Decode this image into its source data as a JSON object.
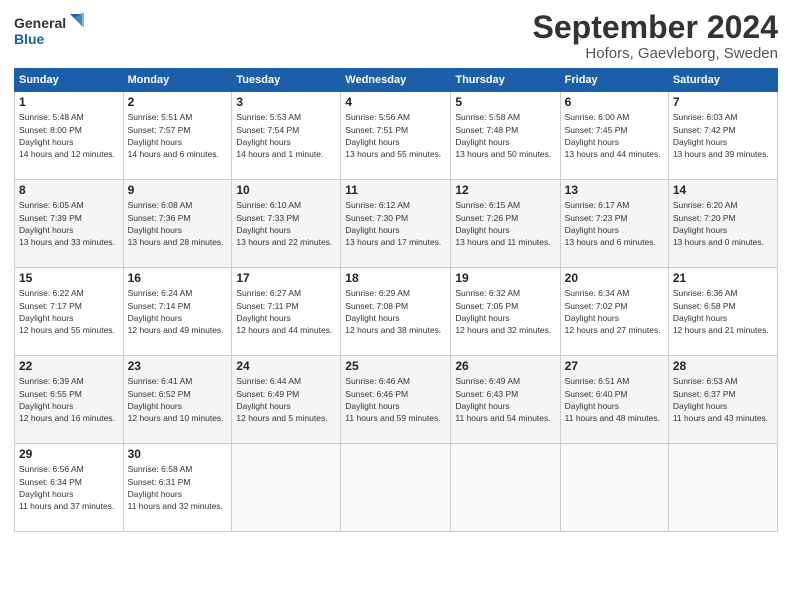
{
  "header": {
    "logo_line1": "General",
    "logo_line2": "Blue",
    "month": "September 2024",
    "location": "Hofors, Gaevleborg, Sweden"
  },
  "weekdays": [
    "Sunday",
    "Monday",
    "Tuesday",
    "Wednesday",
    "Thursday",
    "Friday",
    "Saturday"
  ],
  "weeks": [
    [
      {
        "day": "1",
        "sunrise": "Sunrise: 5:48 AM",
        "sunset": "Sunset: 8:00 PM",
        "daylight": "Daylight: 14 hours and 12 minutes."
      },
      {
        "day": "2",
        "sunrise": "Sunrise: 5:51 AM",
        "sunset": "Sunset: 7:57 PM",
        "daylight": "Daylight: 14 hours and 6 minutes."
      },
      {
        "day": "3",
        "sunrise": "Sunrise: 5:53 AM",
        "sunset": "Sunset: 7:54 PM",
        "daylight": "Daylight: 14 hours and 1 minute."
      },
      {
        "day": "4",
        "sunrise": "Sunrise: 5:56 AM",
        "sunset": "Sunset: 7:51 PM",
        "daylight": "Daylight: 13 hours and 55 minutes."
      },
      {
        "day": "5",
        "sunrise": "Sunrise: 5:58 AM",
        "sunset": "Sunset: 7:48 PM",
        "daylight": "Daylight: 13 hours and 50 minutes."
      },
      {
        "day": "6",
        "sunrise": "Sunrise: 6:00 AM",
        "sunset": "Sunset: 7:45 PM",
        "daylight": "Daylight: 13 hours and 44 minutes."
      },
      {
        "day": "7",
        "sunrise": "Sunrise: 6:03 AM",
        "sunset": "Sunset: 7:42 PM",
        "daylight": "Daylight: 13 hours and 39 minutes."
      }
    ],
    [
      {
        "day": "8",
        "sunrise": "Sunrise: 6:05 AM",
        "sunset": "Sunset: 7:39 PM",
        "daylight": "Daylight: 13 hours and 33 minutes."
      },
      {
        "day": "9",
        "sunrise": "Sunrise: 6:08 AM",
        "sunset": "Sunset: 7:36 PM",
        "daylight": "Daylight: 13 hours and 28 minutes."
      },
      {
        "day": "10",
        "sunrise": "Sunrise: 6:10 AM",
        "sunset": "Sunset: 7:33 PM",
        "daylight": "Daylight: 13 hours and 22 minutes."
      },
      {
        "day": "11",
        "sunrise": "Sunrise: 6:12 AM",
        "sunset": "Sunset: 7:30 PM",
        "daylight": "Daylight: 13 hours and 17 minutes."
      },
      {
        "day": "12",
        "sunrise": "Sunrise: 6:15 AM",
        "sunset": "Sunset: 7:26 PM",
        "daylight": "Daylight: 13 hours and 11 minutes."
      },
      {
        "day": "13",
        "sunrise": "Sunrise: 6:17 AM",
        "sunset": "Sunset: 7:23 PM",
        "daylight": "Daylight: 13 hours and 6 minutes."
      },
      {
        "day": "14",
        "sunrise": "Sunrise: 6:20 AM",
        "sunset": "Sunset: 7:20 PM",
        "daylight": "Daylight: 13 hours and 0 minutes."
      }
    ],
    [
      {
        "day": "15",
        "sunrise": "Sunrise: 6:22 AM",
        "sunset": "Sunset: 7:17 PM",
        "daylight": "Daylight: 12 hours and 55 minutes."
      },
      {
        "day": "16",
        "sunrise": "Sunrise: 6:24 AM",
        "sunset": "Sunset: 7:14 PM",
        "daylight": "Daylight: 12 hours and 49 minutes."
      },
      {
        "day": "17",
        "sunrise": "Sunrise: 6:27 AM",
        "sunset": "Sunset: 7:11 PM",
        "daylight": "Daylight: 12 hours and 44 minutes."
      },
      {
        "day": "18",
        "sunrise": "Sunrise: 6:29 AM",
        "sunset": "Sunset: 7:08 PM",
        "daylight": "Daylight: 12 hours and 38 minutes."
      },
      {
        "day": "19",
        "sunrise": "Sunrise: 6:32 AM",
        "sunset": "Sunset: 7:05 PM",
        "daylight": "Daylight: 12 hours and 32 minutes."
      },
      {
        "day": "20",
        "sunrise": "Sunrise: 6:34 AM",
        "sunset": "Sunset: 7:02 PM",
        "daylight": "Daylight: 12 hours and 27 minutes."
      },
      {
        "day": "21",
        "sunrise": "Sunrise: 6:36 AM",
        "sunset": "Sunset: 6:58 PM",
        "daylight": "Daylight: 12 hours and 21 minutes."
      }
    ],
    [
      {
        "day": "22",
        "sunrise": "Sunrise: 6:39 AM",
        "sunset": "Sunset: 6:55 PM",
        "daylight": "Daylight: 12 hours and 16 minutes."
      },
      {
        "day": "23",
        "sunrise": "Sunrise: 6:41 AM",
        "sunset": "Sunset: 6:52 PM",
        "daylight": "Daylight: 12 hours and 10 minutes."
      },
      {
        "day": "24",
        "sunrise": "Sunrise: 6:44 AM",
        "sunset": "Sunset: 6:49 PM",
        "daylight": "Daylight: 12 hours and 5 minutes."
      },
      {
        "day": "25",
        "sunrise": "Sunrise: 6:46 AM",
        "sunset": "Sunset: 6:46 PM",
        "daylight": "Daylight: 11 hours and 59 minutes."
      },
      {
        "day": "26",
        "sunrise": "Sunrise: 6:49 AM",
        "sunset": "Sunset: 6:43 PM",
        "daylight": "Daylight: 11 hours and 54 minutes."
      },
      {
        "day": "27",
        "sunrise": "Sunrise: 6:51 AM",
        "sunset": "Sunset: 6:40 PM",
        "daylight": "Daylight: 11 hours and 48 minutes."
      },
      {
        "day": "28",
        "sunrise": "Sunrise: 6:53 AM",
        "sunset": "Sunset: 6:37 PM",
        "daylight": "Daylight: 11 hours and 43 minutes."
      }
    ],
    [
      {
        "day": "29",
        "sunrise": "Sunrise: 6:56 AM",
        "sunset": "Sunset: 6:34 PM",
        "daylight": "Daylight: 11 hours and 37 minutes."
      },
      {
        "day": "30",
        "sunrise": "Sunrise: 6:58 AM",
        "sunset": "Sunset: 6:31 PM",
        "daylight": "Daylight: 11 hours and 32 minutes."
      },
      null,
      null,
      null,
      null,
      null
    ]
  ]
}
